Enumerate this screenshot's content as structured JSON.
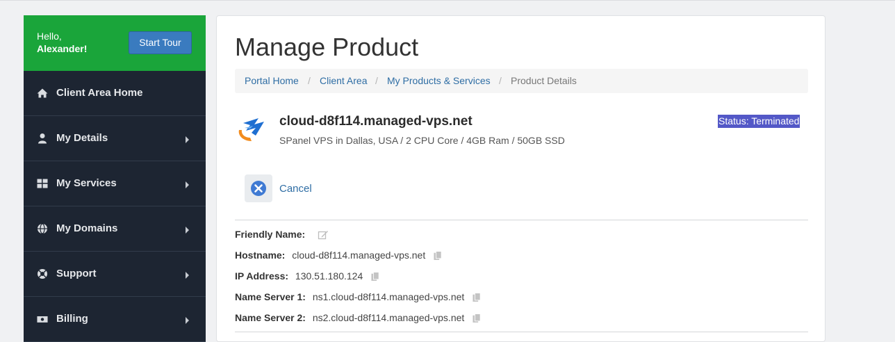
{
  "sidebar": {
    "greeting": "Hello,",
    "user_name": "Alexander!",
    "tour_button": "Start Tour",
    "items": [
      {
        "label": "Client Area Home",
        "icon": "home-icon",
        "has_arrow": false
      },
      {
        "label": "My Details",
        "icon": "user-icon",
        "has_arrow": true
      },
      {
        "label": "My Services",
        "icon": "grid-icon",
        "has_arrow": true
      },
      {
        "label": "My Domains",
        "icon": "globe-icon",
        "has_arrow": true
      },
      {
        "label": "Support",
        "icon": "lifebuoy-icon",
        "has_arrow": true
      },
      {
        "label": "Billing",
        "icon": "money-icon",
        "has_arrow": true
      }
    ]
  },
  "main": {
    "title": "Manage Product",
    "breadcrumb": {
      "items": [
        "Portal Home",
        "Client Area",
        "My Products & Services"
      ],
      "active": "Product Details",
      "separator": "/"
    },
    "product": {
      "name": "cloud-d8f114.managed-vps.net",
      "description": "SPanel VPS in Dallas, USA / 2 CPU Core / 4GB Ram / 50GB SSD",
      "status": "Status: Terminated",
      "logo_icon": "spanel-logo-icon"
    },
    "cancel_label": "Cancel",
    "details": {
      "friendly_name_label": "Friendly Name:",
      "friendly_name_value": "",
      "hostname_label": "Hostname:",
      "hostname_value": "cloud-d8f114.managed-vps.net",
      "ip_label": "IP Address:",
      "ip_value": "130.51.180.124",
      "ns1_label": "Name Server 1:",
      "ns1_value": "ns1.cloud-d8f114.managed-vps.net",
      "ns2_label": "Name Server 2:",
      "ns2_value": "ns2.cloud-d8f114.managed-vps.net"
    }
  },
  "colors": {
    "sidebar_bg": "#1d2532",
    "hello_bg": "#1aa53a",
    "tour_button": "#3a7bbf",
    "link": "#2e6da4",
    "status_badge": "#5358c7"
  }
}
